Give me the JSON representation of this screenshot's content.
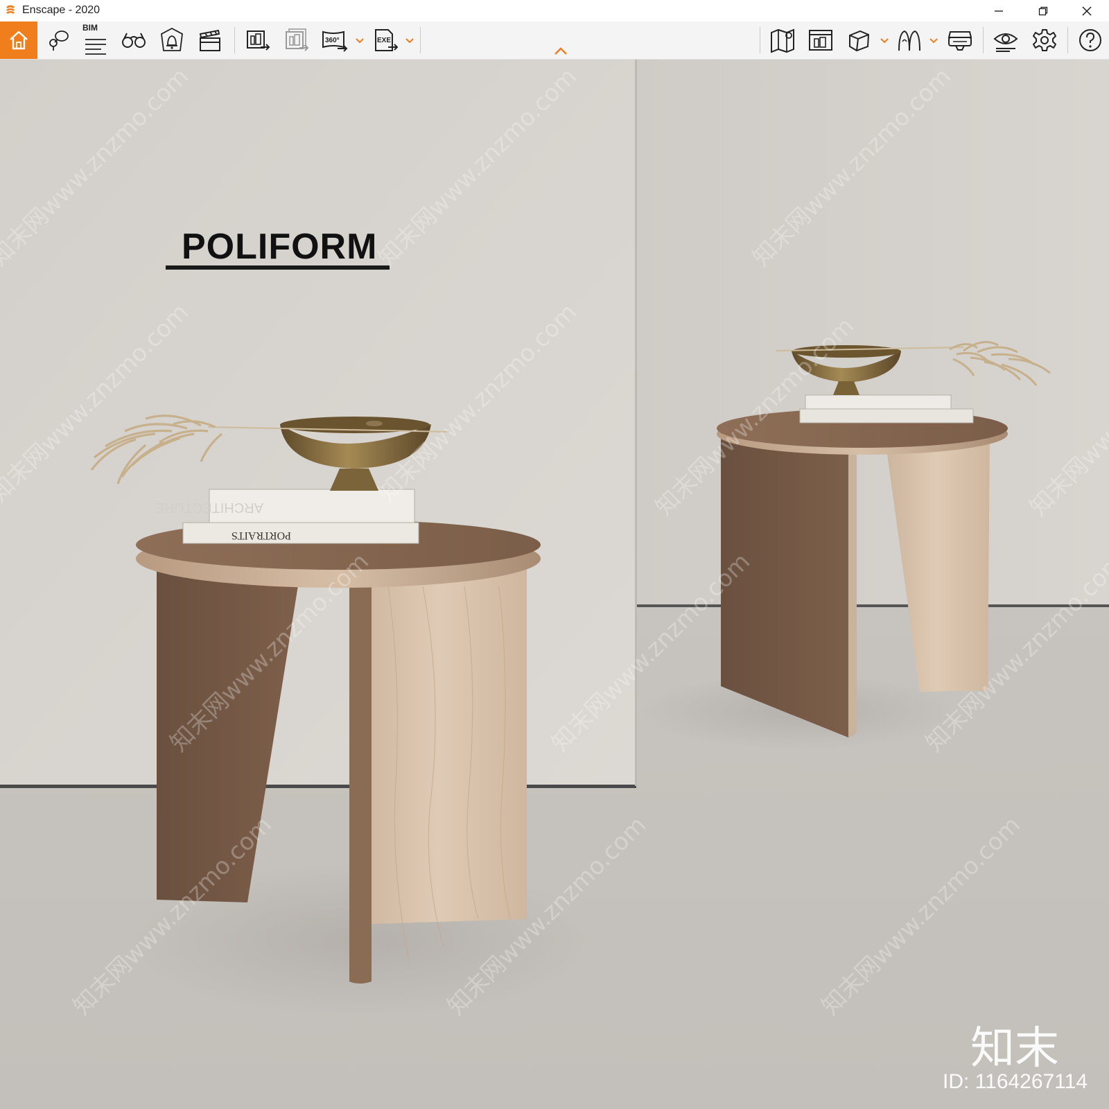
{
  "window": {
    "title": "Enscape - 2020",
    "controls": [
      "minimize",
      "restore",
      "close"
    ]
  },
  "toolbar": {
    "bim_label": "BIM",
    "left_buttons": [
      {
        "name": "home",
        "icon": "home-icon",
        "active": true
      },
      {
        "name": "views",
        "icon": "map-pin-icon"
      },
      {
        "name": "bim",
        "icon": "bim-list-icon"
      },
      {
        "name": "binoculars",
        "icon": "binoculars-icon"
      },
      {
        "name": "atmosphere",
        "icon": "shield-bell-icon"
      },
      {
        "name": "video",
        "icon": "clapperboard-icon"
      },
      {
        "name": "batch-render",
        "icon": "render-export-icon"
      },
      {
        "name": "batch-render-disabled",
        "icon": "render-export-stack-icon"
      },
      {
        "name": "panorama",
        "icon": "panorama-360-icon",
        "label": "360°"
      },
      {
        "name": "exe-export",
        "icon": "exe-export-icon",
        "label": "EXE"
      }
    ],
    "right_buttons": [
      {
        "name": "map",
        "icon": "map-icon"
      },
      {
        "name": "sketch",
        "icon": "sketch-icon"
      },
      {
        "name": "cube",
        "icon": "cube-icon"
      },
      {
        "name": "walk",
        "icon": "walk-icon"
      },
      {
        "name": "vr",
        "icon": "vr-headset-icon"
      },
      {
        "name": "visual-settings",
        "icon": "eye-icon"
      },
      {
        "name": "settings",
        "icon": "gear-icon"
      },
      {
        "name": "help",
        "icon": "help-icon"
      }
    ]
  },
  "scene": {
    "brand_text": "POLIFORM",
    "watermark_text": "知末网www.znzmo.com",
    "corner_mark": "知末",
    "id_text": "ID: 1164267114",
    "book_titles": [
      "ARCHITECTURE",
      "PORTRAITS"
    ]
  },
  "colors": {
    "accent": "#f07e1d",
    "wall": "#d8d4cf",
    "floor": "#c9c5c0",
    "wood_dark": "#7a5e4a",
    "wood_light": "#d9c3ae",
    "brass": "#8f7441"
  }
}
